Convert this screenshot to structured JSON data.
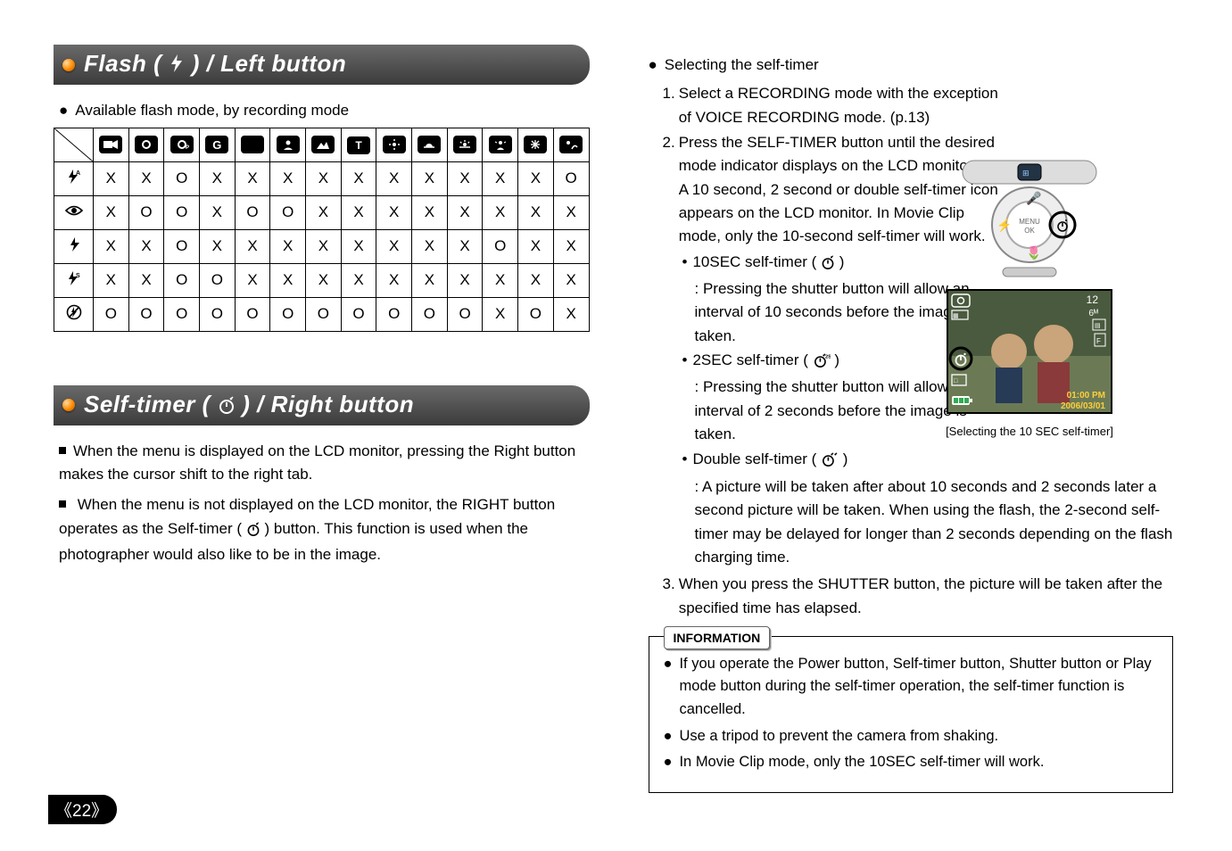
{
  "page_number_display": "《22》",
  "left": {
    "title": "Flash (      ) / Left button",
    "title_icon": "flash-icon",
    "bullet": "Available flash mode, by recording mode"
  },
  "flash_table": {
    "col_icons": [
      "movie",
      "auto",
      "program",
      "manual",
      "macro",
      "portrait",
      "landscape",
      "text",
      "closeup",
      "sunset",
      "dawn",
      "backlight",
      "fireworks",
      "beach"
    ],
    "rows": [
      {
        "icon": "flash-auto",
        "cells": [
          "X",
          "X",
          "O",
          "X",
          "X",
          "X",
          "X",
          "X",
          "X",
          "X",
          "X",
          "X",
          "X",
          "O"
        ]
      },
      {
        "icon": "redeye",
        "cells": [
          "X",
          "O",
          "O",
          "X",
          "O",
          "O",
          "X",
          "X",
          "X",
          "X",
          "X",
          "X",
          "X",
          "X"
        ]
      },
      {
        "icon": "flash-fill",
        "cells": [
          "X",
          "X",
          "O",
          "X",
          "X",
          "X",
          "X",
          "X",
          "X",
          "X",
          "X",
          "O",
          "X",
          "X"
        ]
      },
      {
        "icon": "flash-slow",
        "cells": [
          "X",
          "X",
          "O",
          "O",
          "X",
          "X",
          "X",
          "X",
          "X",
          "X",
          "X",
          "X",
          "X",
          "X"
        ]
      },
      {
        "icon": "flash-off",
        "cells": [
          "O",
          "O",
          "O",
          "O",
          "O",
          "O",
          "O",
          "O",
          "O",
          "O",
          "O",
          "X",
          "O",
          "X"
        ]
      }
    ]
  },
  "selftimer_section": {
    "title": "Self-timer (      ) / Right button",
    "para1": "When the menu is displayed on the LCD monitor, pressing the Right button makes the cursor shift to the right tab.",
    "para2": "When the menu is not displayed on the LCD monitor, the RIGHT button operates as the Self-timer (      ) button. This function is used when the photographer would also like to be in the image."
  },
  "right": {
    "heading_bullet": "Selecting the self-timer",
    "step1": "Select a RECORDING mode with the exception of VOICE RECORDING mode. (p.13)",
    "step2_a": "Press the SELF-TIMER button until the desired mode indicator displays on the LCD monitor.",
    "step2_b": "A 10 second, 2 second or double self-timer icon appears on the LCD monitor. In Movie Clip mode, only the 10-second self-timer will work.",
    "t10_label": "10SEC self-timer (       )",
    "t10_desc": ": Pressing the shutter button will allow an interval of 10 seconds before the image is taken.",
    "t2_label": "2SEC self-timer (        )",
    "t2_desc": ": Pressing the shutter button will allow an interval of 2 seconds before the image is taken.",
    "tdouble_label": "Double self-timer (        )",
    "tdouble_desc": ": A picture will be taken after about 10 seconds and 2 seconds later a second picture will be taken. When using the flash, the 2-second self-timer may be delayed for longer than 2 seconds depending on the flash charging time.",
    "step3": "When you press the SHUTTER button, the picture will be taken after the specified time has elapsed.",
    "caption": "[Selecting the 10 SEC self-timer]",
    "lcd_overlay": {
      "top_left_count": "12",
      "quality": "6M",
      "time": "01:00 PM",
      "date": "2006/03/01"
    }
  },
  "info": {
    "label": "INFORMATION",
    "items": [
      "If you operate the Power button, Self-timer button, Shutter button or Play mode button during the self-timer operation, the self-timer function is cancelled.",
      "Use a tripod to prevent the camera from shaking.",
      "In Movie Clip mode, only the 10SEC self-timer will work."
    ]
  }
}
